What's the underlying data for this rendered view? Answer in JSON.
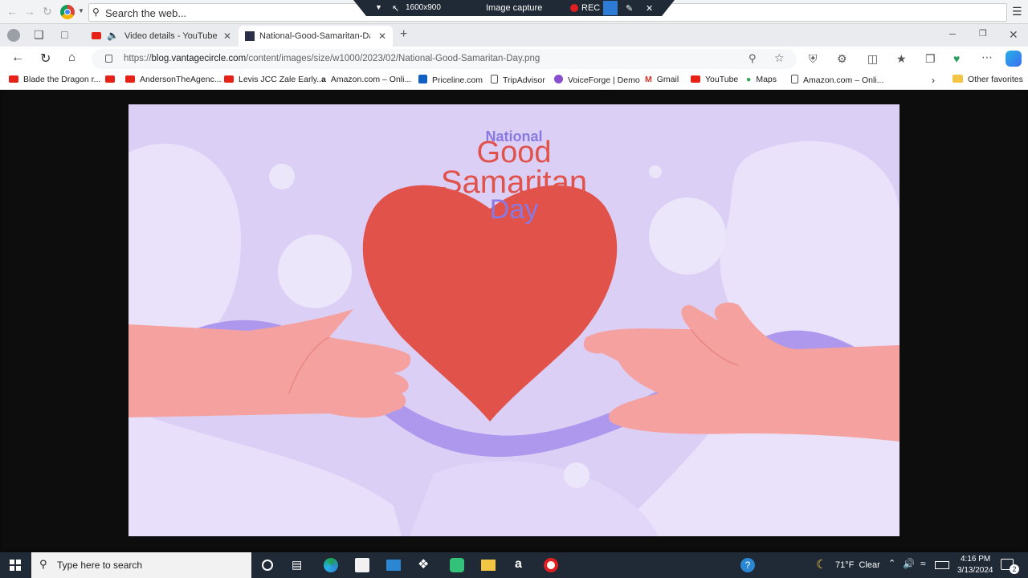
{
  "outer_browser": {
    "search_label": "Search the web..."
  },
  "capture_bar": {
    "resolution": "1600x900",
    "mode": "Image capture",
    "rec_label": "REC"
  },
  "tabs": [
    {
      "label": "Video details - YouTube Stu"
    },
    {
      "label": "National-Good-Samaritan-Day.p"
    }
  ],
  "address": {
    "scheme": "https://",
    "host": "blog.vantagecircle.com",
    "path": "/content/images/size/w1000/2023/02/National-Good-Samaritan-Day.png"
  },
  "bookmarks": [
    {
      "label": "Blade the Dragon r..."
    },
    {
      "label": "AndersonTheAgenc..."
    },
    {
      "label": "Levis JCC Zale Early..."
    },
    {
      "label": "Amazon.com – Onli..."
    },
    {
      "label": "Priceline.com"
    },
    {
      "label": "TripAdvisor"
    },
    {
      "label": "VoiceForge | Demo"
    },
    {
      "label": "Gmail"
    },
    {
      "label": "YouTube"
    },
    {
      "label": "Maps"
    },
    {
      "label": "Amazon.com – Onli..."
    },
    {
      "label": "Other favorites"
    }
  ],
  "artwork": {
    "line1": "National",
    "line2": "Good",
    "line3": "Samaritan",
    "line4": "Day"
  },
  "taskbar": {
    "search_placeholder": "Type here to search",
    "weather": "71°F  Clear",
    "time": "4:16 PM",
    "date": "3/13/2024",
    "notification_count": "2"
  },
  "colors": {
    "art_bg": "#dccff5",
    "heart": "#e0524a",
    "ribbon": "#ad98ee",
    "hand": "#f4a19f",
    "title_red": "#e0524a",
    "title_purple": "#8a79e0",
    "taskbar": "#202a36"
  }
}
